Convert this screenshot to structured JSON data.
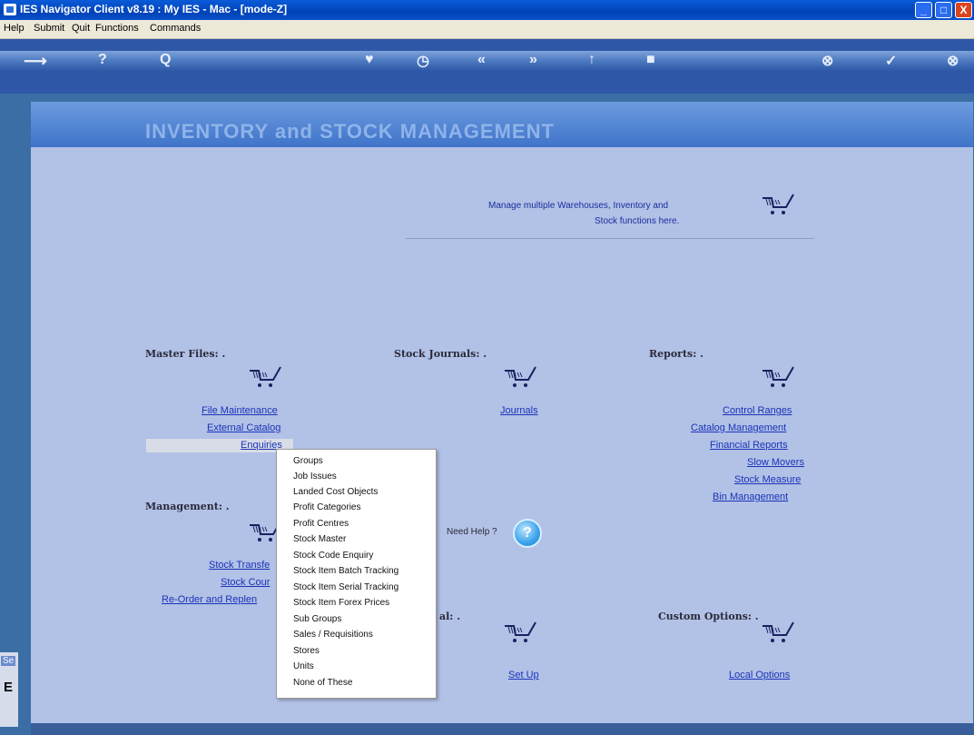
{
  "window": {
    "title": "IES Navigator Client v8.19 : My IES - Mac -       [mode-Z]",
    "buttons": {
      "minimize": "_",
      "maximize": "□",
      "close": "X"
    }
  },
  "menu": [
    "Help",
    "Submit",
    "Quit",
    "Functions",
    "Commands"
  ],
  "toolbar": {
    "icons": [
      "back-arrow-icon",
      "help-icon",
      "search-icon",
      "heart-icon",
      "clock-icon",
      "rewind-icon",
      "fast-forward-icon",
      "upload-icon",
      "stop-icon",
      "cancel-icon",
      "confirm-icon",
      "close-icon"
    ],
    "glyphs": {
      "help": "?",
      "search": "Q",
      "heart": "♥",
      "clock": "◷",
      "rewind": "«",
      "forward": "»",
      "up": "↑",
      "stop": "■",
      "cancel": "⊗",
      "confirm": "✓",
      "close": "⊗"
    }
  },
  "banner": {
    "title": "INVENTORY and STOCK MANAGEMENT"
  },
  "description": {
    "line1": "Manage multiple Warehouses, Inventory and",
    "line2": "Stock functions here."
  },
  "sections": {
    "master_files": {
      "heading": "Master Files: .",
      "links": [
        "File Maintenance",
        "External Catalog",
        "Enquiries"
      ]
    },
    "stock_journals": {
      "heading": "Stock Journals: .",
      "links": [
        "Journals"
      ]
    },
    "reports": {
      "heading": "Reports: .",
      "links": [
        "Control Ranges",
        "Catalog Management",
        "Financial Reports",
        "Slow Movers",
        "Stock Measure",
        "Bin Management"
      ]
    },
    "management": {
      "heading": "Management: .",
      "links": [
        "Stock Transfe",
        "Stock Cour",
        "Re-Order and Replen"
      ]
    },
    "setup": {
      "heading": "al: .",
      "links": [
        "Set Up"
      ]
    },
    "custom_options": {
      "heading": "Custom Options: .",
      "links": [
        "Local Options"
      ]
    }
  },
  "help": {
    "label": "Need Help ?",
    "glyph": "?"
  },
  "popup_menu": {
    "items": [
      "Groups",
      "Job Issues",
      "Landed Cost Objects",
      "Profit Categories",
      "Profit Centres",
      "Stock Master",
      "Stock Code Enquiry",
      "Stock Item Batch Tracking",
      "Stock Item Serial Tracking",
      "Stock Item Forex Prices",
      "Sub Groups",
      "Sales / Requisitions",
      "Stores",
      "Units",
      "None of These"
    ]
  },
  "side_tab": {
    "label": "Se",
    "letter": "E"
  },
  "colors": {
    "link": "#1a34b8",
    "panel": "#b2c1e6",
    "banner": "#4f82d0",
    "titlebar": "#0a4fc8"
  }
}
